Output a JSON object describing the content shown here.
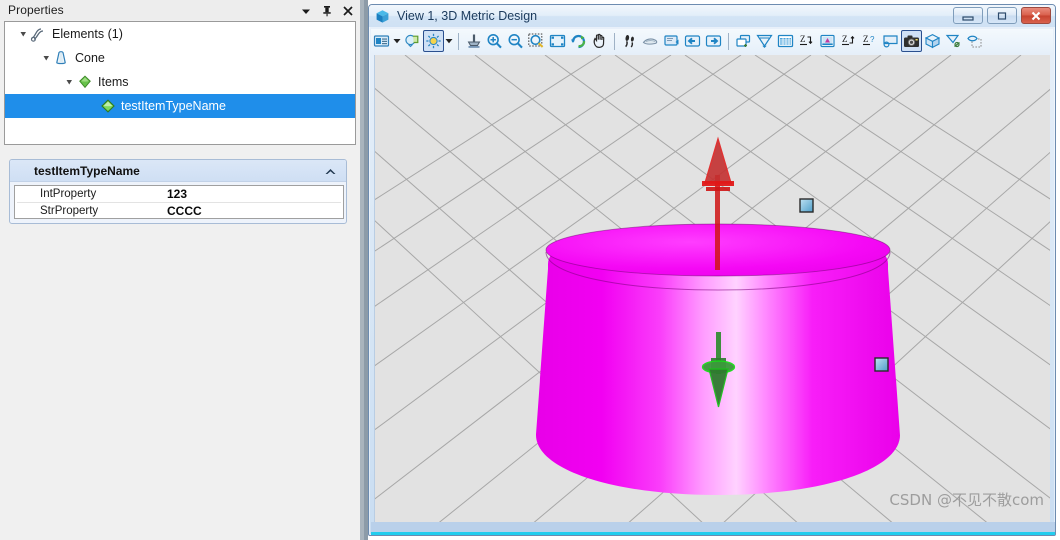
{
  "properties_panel": {
    "title": "Properties",
    "title_icons": [
      {
        "name": "chevron-down-icon",
        "label": "Dropdown"
      },
      {
        "name": "pin-icon",
        "label": "Auto Hide"
      },
      {
        "name": "close-icon",
        "label": "Close"
      }
    ],
    "tree": [
      {
        "label": "Elements (1)",
        "icon": "elements-curve-icon",
        "depth": 0,
        "expanded": true,
        "selected": false
      },
      {
        "label": "Cone",
        "icon": "cone-icon",
        "depth": 1,
        "expanded": true,
        "selected": false
      },
      {
        "label": "Items",
        "icon": "green-gem-icon",
        "depth": 2,
        "expanded": true,
        "selected": false
      },
      {
        "label": "testItemTypeName",
        "icon": "green-diamond-icon",
        "depth": 3,
        "expanded": false,
        "selected": true
      }
    ],
    "property_card": {
      "title": "testItemTypeName",
      "collapse_icon": "chevron-up-icon",
      "rows": [
        {
          "name": "IntProperty",
          "value": "123"
        },
        {
          "name": "StrProperty",
          "value": "CCCC"
        }
      ]
    }
  },
  "view_window": {
    "title": "View 1, 3D Metric Design",
    "title_icon": "cube-icon",
    "window_buttons": [
      {
        "name": "minimize-button",
        "label": "Minimize",
        "glyph": "minimize"
      },
      {
        "name": "maximize-button",
        "label": "Maximize",
        "glyph": "maximize"
      },
      {
        "name": "close-button",
        "label": "Close",
        "glyph": "close"
      }
    ],
    "toolbar": [
      {
        "name": "view-attributes-icon",
        "kind": "icon",
        "selected": false
      },
      {
        "name": "view-attributes-caret-icon",
        "kind": "caret"
      },
      {
        "name": "clip-volume-icon",
        "kind": "icon",
        "selected": false
      },
      {
        "name": "display-style-icon",
        "kind": "icon",
        "selected": true
      },
      {
        "name": "display-style-caret-icon",
        "kind": "caret"
      },
      {
        "name": "separator",
        "kind": "sep"
      },
      {
        "name": "update-view-icon",
        "kind": "icon",
        "selected": false
      },
      {
        "name": "zoom-in-icon",
        "kind": "icon",
        "selected": false
      },
      {
        "name": "zoom-out-icon",
        "kind": "icon",
        "selected": false
      },
      {
        "name": "window-area-icon",
        "kind": "icon",
        "selected": false
      },
      {
        "name": "fit-view-icon",
        "kind": "icon",
        "selected": false
      },
      {
        "name": "rotate-view-icon",
        "kind": "icon",
        "selected": false
      },
      {
        "name": "pan-view-icon",
        "kind": "icon",
        "selected": false
      },
      {
        "name": "separator",
        "kind": "sep"
      },
      {
        "name": "walk-view-icon",
        "kind": "icon",
        "selected": false
      },
      {
        "name": "look-around-icon",
        "kind": "icon",
        "selected": false
      },
      {
        "name": "view-previous-icon",
        "kind": "icon",
        "selected": false
      },
      {
        "name": "view-next-back-icon",
        "kind": "icon",
        "selected": false
      },
      {
        "name": "view-next-forward-icon",
        "kind": "icon",
        "selected": false
      },
      {
        "name": "separator",
        "kind": "sep"
      },
      {
        "name": "copy-view-icon",
        "kind": "icon",
        "selected": false
      },
      {
        "name": "clip-mask-icon",
        "kind": "icon",
        "selected": false
      },
      {
        "name": "render-icon",
        "kind": "icon",
        "selected": false
      },
      {
        "name": "z-front-icon",
        "kind": "icon",
        "selected": false
      },
      {
        "name": "display-set-icon",
        "kind": "icon",
        "selected": false
      },
      {
        "name": "z-back-icon",
        "kind": "icon",
        "selected": false
      },
      {
        "name": "z-query-icon",
        "kind": "icon",
        "selected": false
      },
      {
        "name": "view-display-mode-icon",
        "kind": "icon",
        "selected": false
      },
      {
        "name": "camera-icon",
        "kind": "icon",
        "selected": true
      },
      {
        "name": "solid-cube-icon",
        "kind": "icon",
        "selected": false
      },
      {
        "name": "clip-element-icon",
        "kind": "icon",
        "selected": false
      },
      {
        "name": "clip-back-icon",
        "kind": "icon",
        "selected": false
      }
    ],
    "viewport": {
      "background_color": "#e2e2e2",
      "grid_color": "#9d9d9d",
      "model": {
        "name": "cone-frustum",
        "color": "#f808f8",
        "highlight_color": "#ffd7ff"
      },
      "manipulators": [
        {
          "name": "top-arrow-handle",
          "color": "#d41f1f",
          "direction": "up"
        },
        {
          "name": "bottom-arrow-handle",
          "color": "#1f9a1f",
          "direction": "down"
        },
        {
          "name": "top-right-square-handle",
          "color": "#7fbfe0"
        },
        {
          "name": "right-square-handle",
          "color": "#7fbfe0"
        }
      ]
    },
    "watermark": "CSDN @不见不散com"
  }
}
